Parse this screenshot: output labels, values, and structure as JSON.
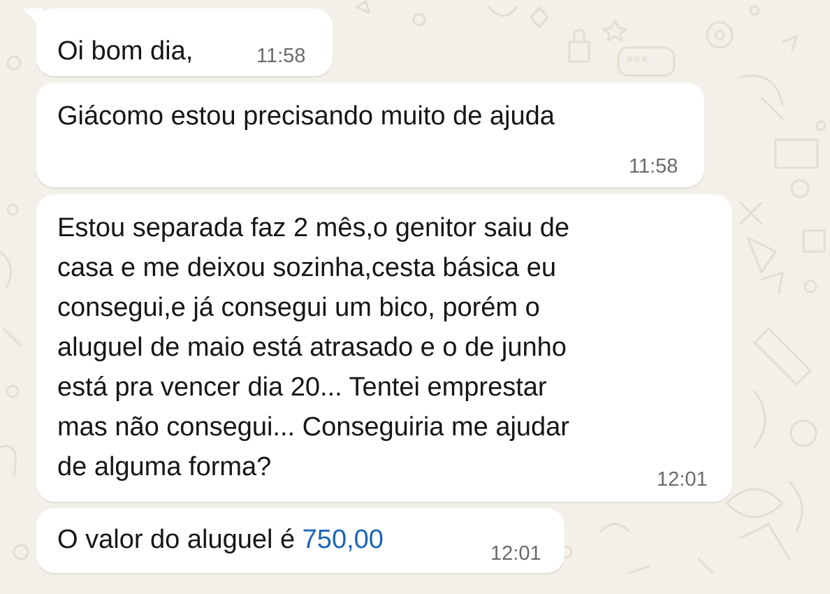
{
  "conversation": {
    "messages": [
      {
        "text": "Oi bom dia,",
        "time": "11:58"
      },
      {
        "text": "Giácomo estou precisando muito de ajuda",
        "time": "11:58"
      },
      {
        "text": "Estou separada faz 2 mês,o genitor saiu de\ncasa e me deixou sozinha,cesta básica eu\nconsegui,e já consegui um bico, porém o\naluguel de maio está atrasado e o de junho\nestá pra vencer dia 20... Tentei emprestar\nmas não consegui... Conseguiria me ajudar\nde alguma forma?",
        "time": "12:01"
      },
      {
        "text_prefix": "O valor do aluguel é ",
        "amount": "750,00",
        "time": "12:01"
      }
    ]
  },
  "theme": {
    "wallpaper_color": "#f3efe9",
    "doodle_color": "#e5ddd2",
    "bubble_color": "#ffffff",
    "amount_link_color": "#1a65b8"
  },
  "icons": [
    "wallpaper-doodle-pattern"
  ]
}
